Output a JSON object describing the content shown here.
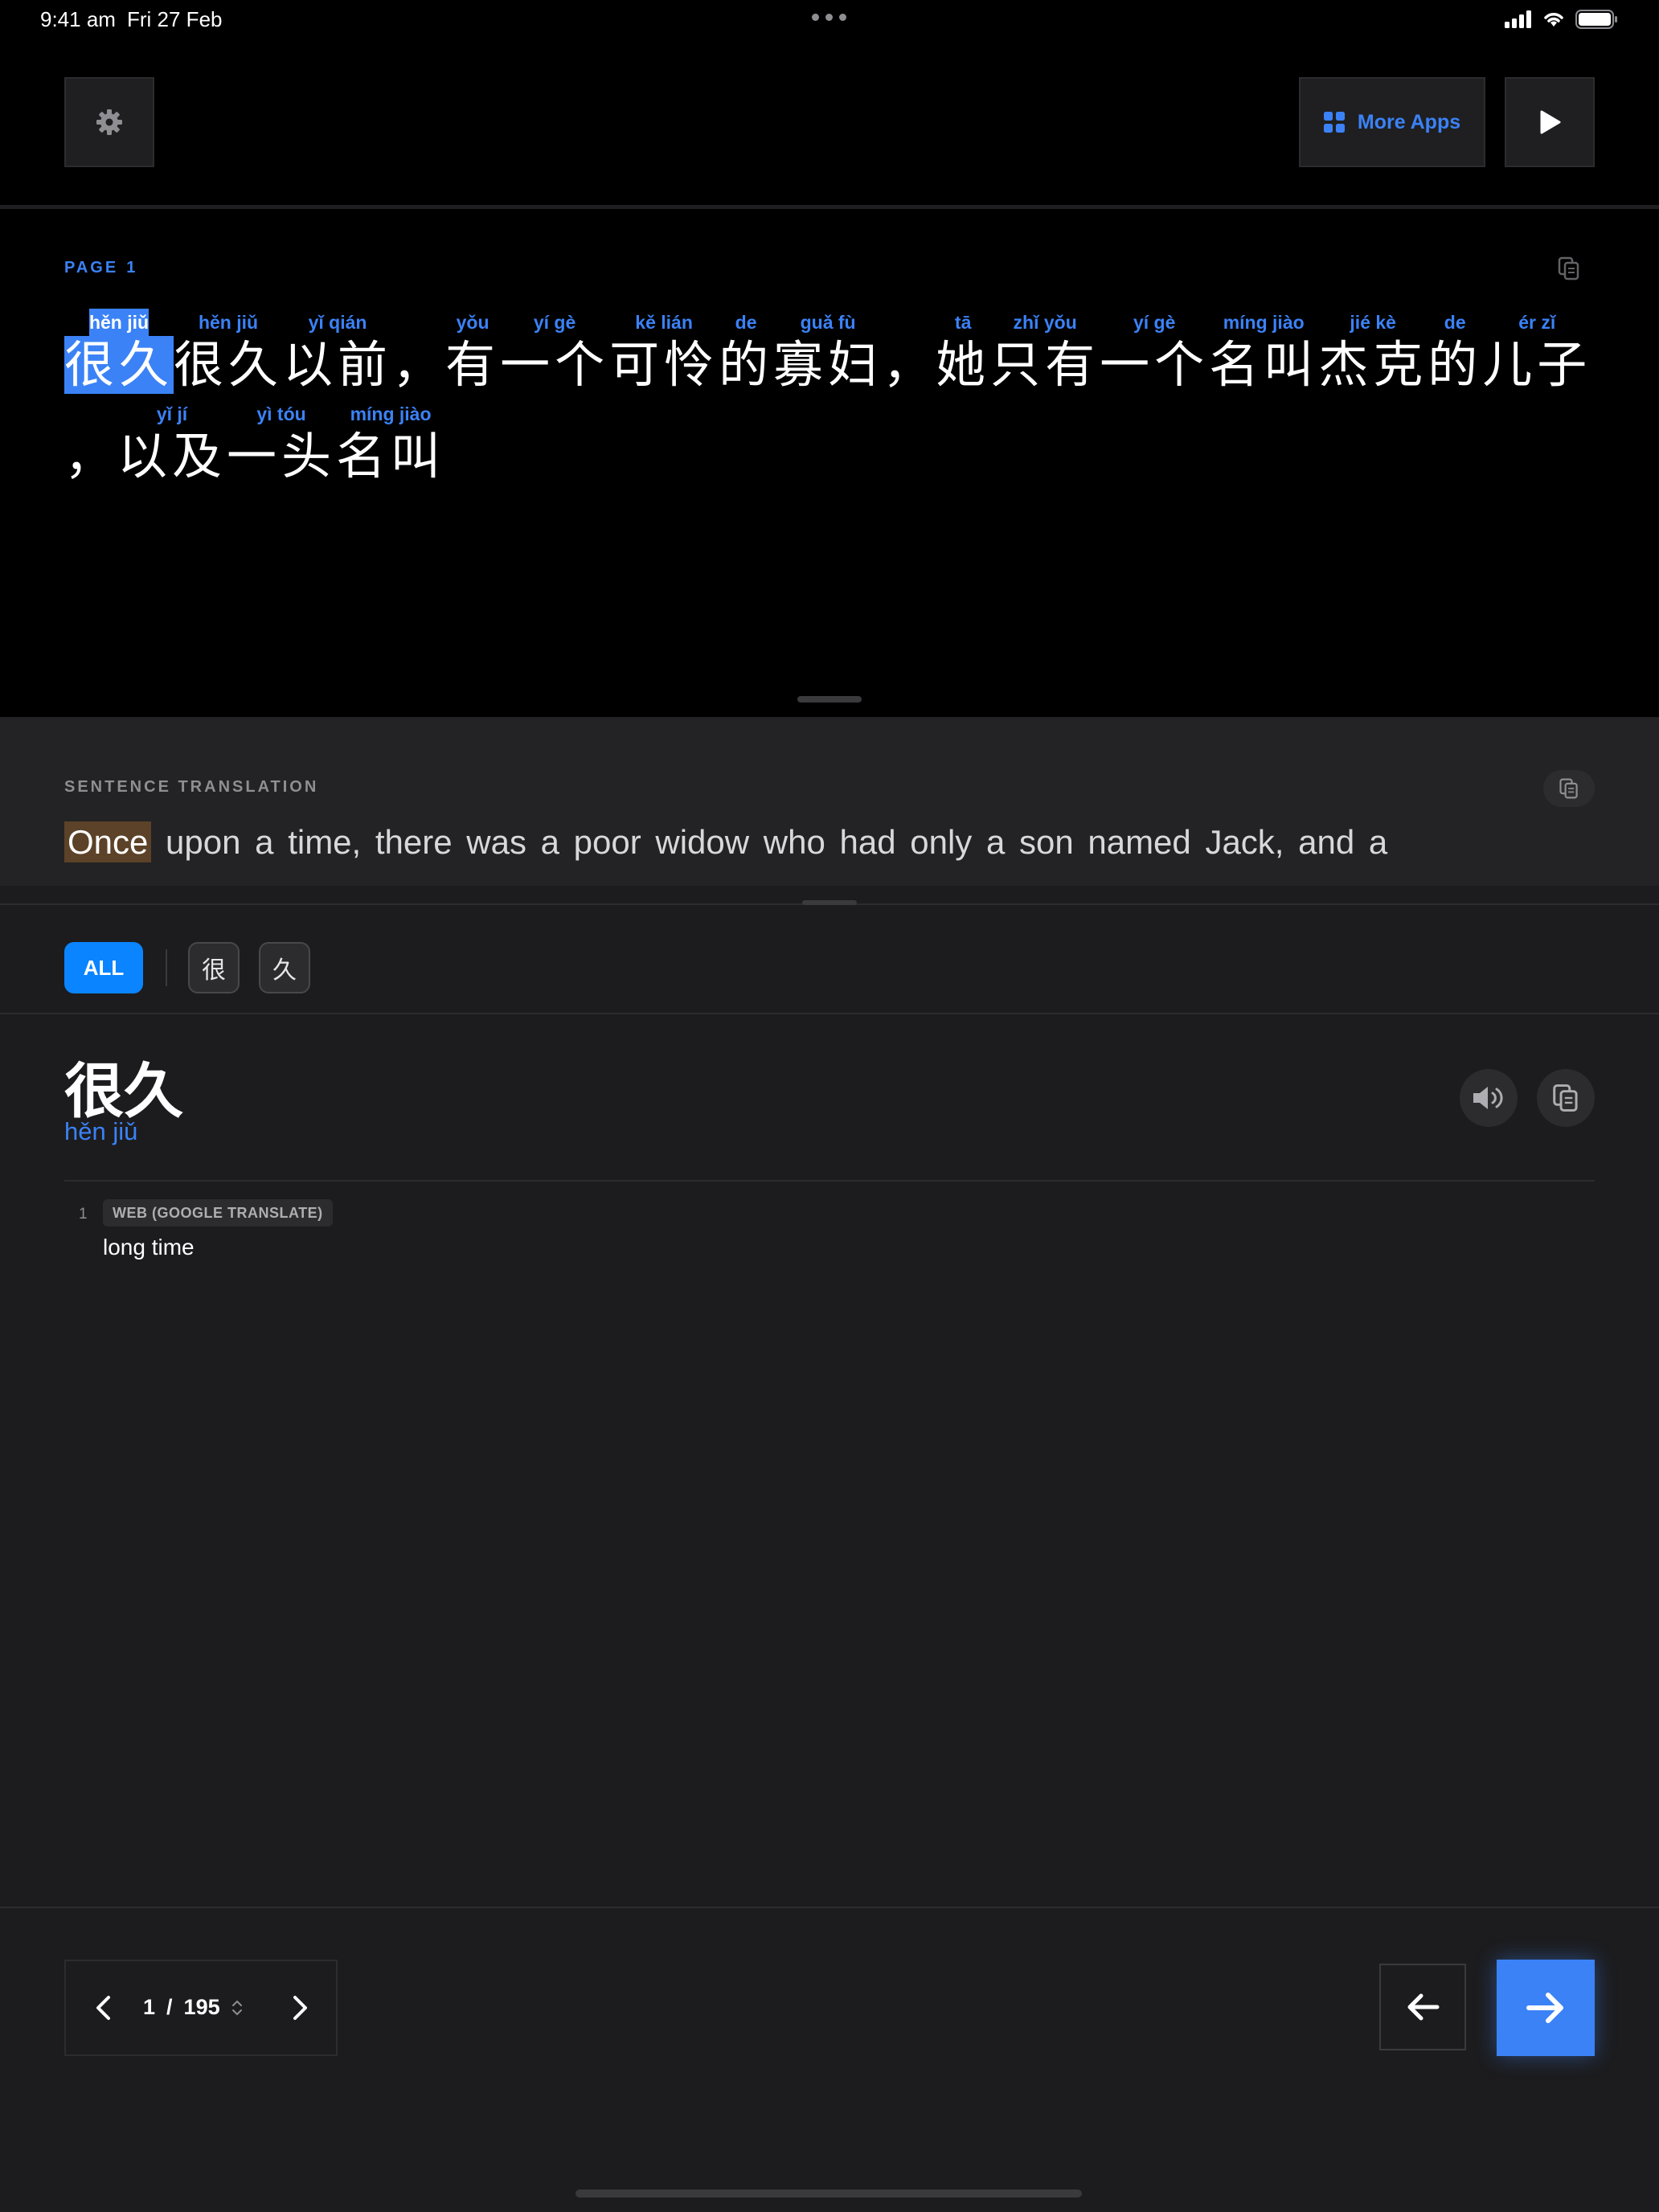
{
  "status_bar": {
    "time": "9:41 am",
    "date": "Fri 27 Feb"
  },
  "toolbar": {
    "more_apps_label": "More Apps"
  },
  "reader": {
    "page_label": "PAGE",
    "page_number": "1",
    "line1": [
      {
        "py": "hěn jiǔ",
        "hz": "很久",
        "active": true
      },
      {
        "py": "hěn jiǔ",
        "hz": "很久"
      },
      {
        "py": "yǐ qián",
        "hz": "以前"
      },
      {
        "py": "",
        "hz": "，"
      },
      {
        "py": "yǒu",
        "hz": "有"
      },
      {
        "py": "yí gè",
        "hz": "一个"
      },
      {
        "py": "kě lián",
        "hz": "可怜"
      },
      {
        "py": "de",
        "hz": "的"
      },
      {
        "py": "guǎ fù",
        "hz": "寡妇"
      },
      {
        "py": "",
        "hz": "，"
      },
      {
        "py": "tā",
        "hz": "她"
      },
      {
        "py": "zhǐ yǒu",
        "hz": "只有"
      },
      {
        "py": "yí gè",
        "hz": "一个"
      },
      {
        "py": "míng jiào",
        "hz": "名叫"
      },
      {
        "py": "jié kè",
        "hz": "杰克"
      },
      {
        "py": "de",
        "hz": "的"
      },
      {
        "py": "ér zǐ",
        "hz": "儿子"
      }
    ],
    "line2": [
      {
        "py": "",
        "hz": "，"
      },
      {
        "py": "yǐ jí",
        "hz": "以及"
      },
      {
        "py": "yì tóu",
        "hz": "一头"
      },
      {
        "py": "míng jiào",
        "hz": "名叫"
      }
    ]
  },
  "sentence": {
    "label": "SENTENCE TRANSLATION",
    "highlight_word": "Once",
    "rest": " upon a time, there was a poor widow who had only a son named Jack, and a"
  },
  "filters": {
    "all_label": "ALL",
    "chars": [
      "很",
      "久"
    ]
  },
  "entry": {
    "word": "很久",
    "pinyin": "hěn jiǔ",
    "definitions": [
      {
        "index": "1",
        "source": "WEB (GOOGLE TRANSLATE)",
        "text": "long time"
      }
    ]
  },
  "pager": {
    "current": "1",
    "separator": "/",
    "total": "195"
  },
  "colors": {
    "accent": "#3b82f6",
    "highlight_bg": "#5c4228",
    "background": "#1c1c1e"
  }
}
